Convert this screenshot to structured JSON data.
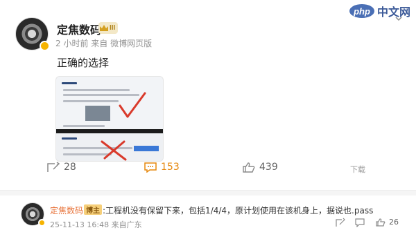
{
  "watermark": {
    "badge_text": "php",
    "site_text": "中文网"
  },
  "post": {
    "author": "定焦数码",
    "level_badge": "III",
    "meta": "2 小时前  来自 微博网页版",
    "text": "正确的选择",
    "image_alt_icons": [
      "checkmark-icon",
      "cross-icon"
    ]
  },
  "actions": {
    "repost_count": "28",
    "comment_count": "153",
    "like_count": "439",
    "more_label": "下载"
  },
  "comment": {
    "author": "定焦数码",
    "tag": "博主",
    "text": ":工程机没有保留下来，包括1/4/4，原计划使用在该机身上，据说也.pass",
    "time": "25-11-13 16:48",
    "location": "来自广东",
    "like_count": "26"
  },
  "colors": {
    "accent_orange": "#e6870c",
    "name_orange": "#e8733a",
    "check_red": "#d93a2b",
    "meta_gray": "#939393"
  }
}
